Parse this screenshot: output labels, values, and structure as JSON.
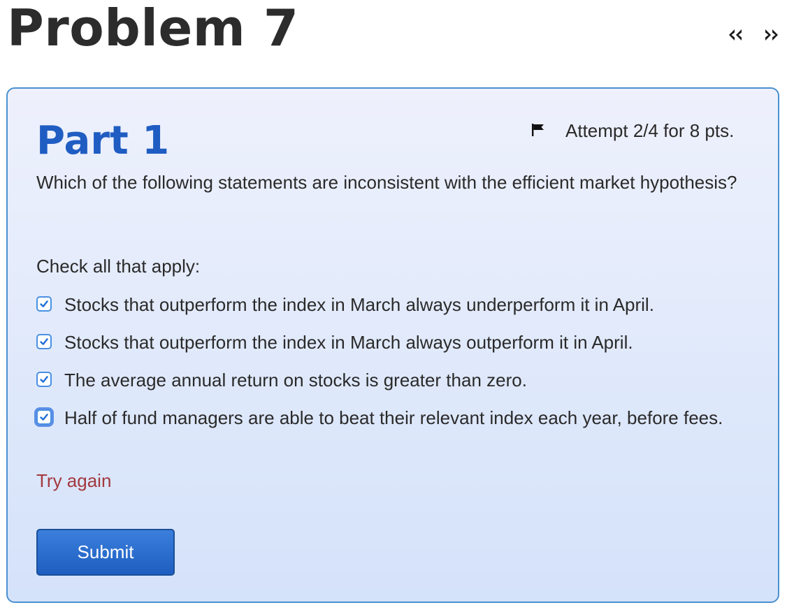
{
  "problem": {
    "title": "Problem 7"
  },
  "navigation": {
    "prev_icon": "double-chevron-left-icon",
    "next_icon": "double-chevron-right-icon"
  },
  "part": {
    "title": "Part 1",
    "flag_icon": "flag-icon",
    "attempt_text": "Attempt 2/4 for 8 pts.",
    "question": "Which of the following statements are inconsistent with the efficient market hypothesis?",
    "instruction": "Check all that apply:",
    "options": [
      {
        "label": "Stocks that outperform the index in March always underperform it in April.",
        "checked": true
      },
      {
        "label": "Stocks that outperform the index in March always outperform it in April.",
        "checked": true
      },
      {
        "label": "The average annual return on stocks is greater than zero.",
        "checked": true
      },
      {
        "label": "Half of fund managers are able to beat their relevant index each year, before fees.",
        "checked": true
      }
    ],
    "feedback": "Try again",
    "submit_label": "Submit"
  },
  "colors": {
    "part_title": "#1f5dc2",
    "card_border": "#4a90d0",
    "feedback": "#a3393f",
    "submit_bg": "#1d5ec0",
    "checkbox_accent": "#1f6fd6"
  }
}
